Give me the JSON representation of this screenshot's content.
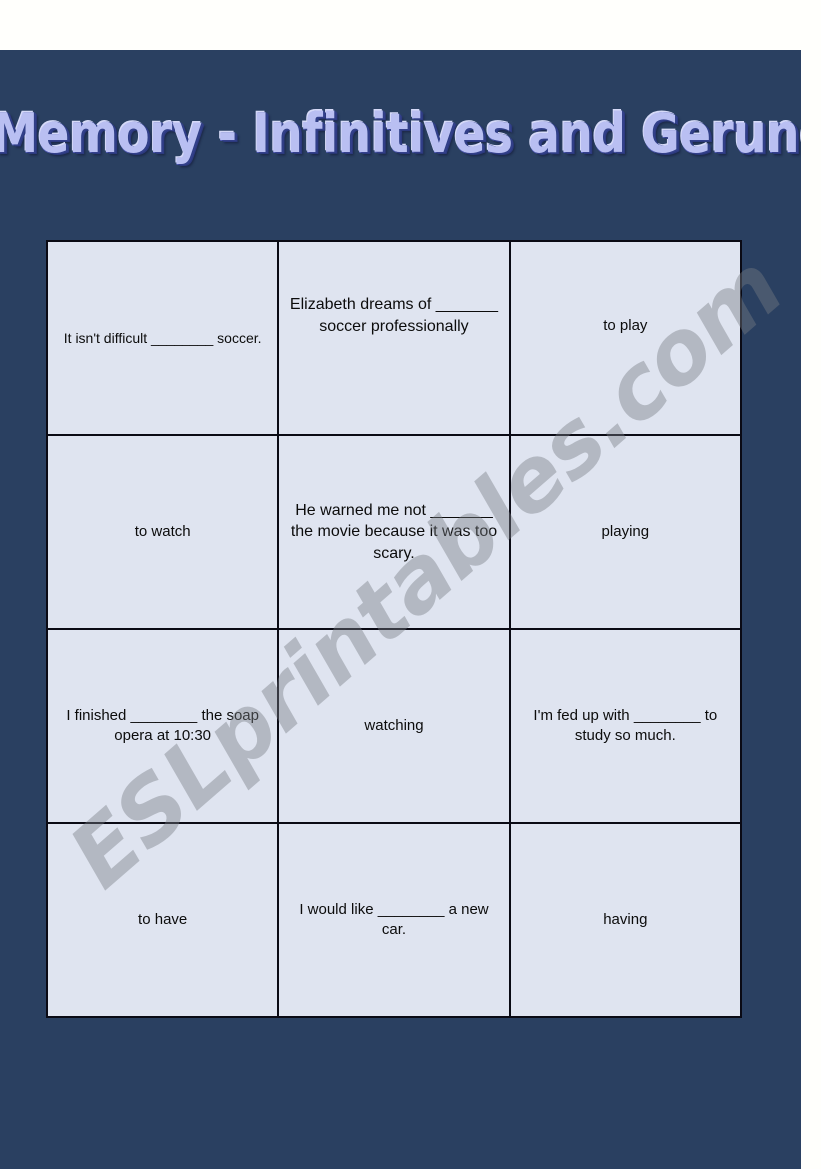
{
  "page": {
    "background_color": "#2a4061",
    "margin_color": "#fffffc",
    "cell_color": "#dfe4f0",
    "title_color": "#b9bff2",
    "border_color": "#0a0a14"
  },
  "title": "Memory - Infinitives and Gerunds",
  "watermark": "ESLprintables.com",
  "table": {
    "columns": 3,
    "rows": 4,
    "cells": [
      {
        "text": "It isn't difficult ________ soccer.",
        "kind": "prompt"
      },
      {
        "text": "Elizabeth dreams of _______ soccer professionally",
        "kind": "prompt"
      },
      {
        "text": "to play",
        "kind": "answer"
      },
      {
        "text": "to watch",
        "kind": "answer"
      },
      {
        "text": "He warned me not _______ the movie because it was too scary.",
        "kind": "prompt"
      },
      {
        "text": "playing",
        "kind": "answer"
      },
      {
        "text": "I finished ________ the soap opera at 10:30",
        "kind": "prompt"
      },
      {
        "text": "watching",
        "kind": "answer"
      },
      {
        "text": "I'm fed up with ________ to study so much.",
        "kind": "prompt"
      },
      {
        "text": "to have",
        "kind": "answer"
      },
      {
        "text": "I would like ________ a new car.",
        "kind": "prompt"
      },
      {
        "text": "having",
        "kind": "answer"
      }
    ]
  }
}
